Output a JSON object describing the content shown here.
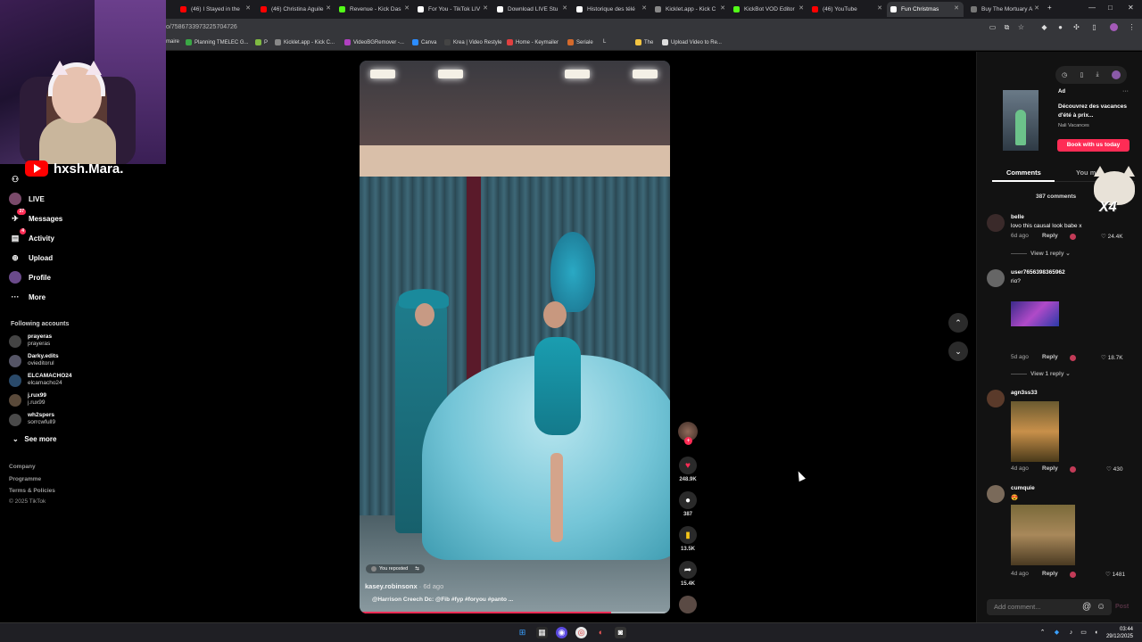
{
  "browser": {
    "tabs": [
      {
        "label": "(46) I Stayed in the",
        "color": "#ff0000"
      },
      {
        "label": "(46) Christina Aguile",
        "color": "#ff0000"
      },
      {
        "label": "Revenue - Kick Das",
        "color": "#53fc18"
      },
      {
        "label": "For You - TikTok LIV",
        "color": "#ffffff"
      },
      {
        "label": "Download LIVE Stu",
        "color": "#ffffff"
      },
      {
        "label": "Historique des télé",
        "color": "#ffffff"
      },
      {
        "label": "Kicklet.app - Kick C",
        "color": "#888888"
      },
      {
        "label": "KickBot VOD Editor",
        "color": "#53fc18"
      },
      {
        "label": "(46) YouTube",
        "color": "#ff0000"
      },
      {
        "label": "Fun Christmas",
        "color": "#ffffff"
      },
      {
        "label": "Buy The Mortuary A",
        "color": "#777777"
      }
    ],
    "url": "o/7586733973225704726",
    "bookmarks": [
      "maire",
      "Planning TMELEC G...",
      "P",
      "Kicklet.app - Kick C...",
      "VideoBGRemover -...",
      "Canva",
      "Krea | Video Restyle",
      "Home - Keymailer",
      "Seriale",
      "L",
      "The",
      "Upload Video to Re..."
    ]
  },
  "stream_overlay": {
    "channel_name": "hxsh.Mara."
  },
  "sidebar": {
    "nav": [
      {
        "label": "LIVE",
        "icon": "live-icon",
        "badge": ""
      },
      {
        "label": "Messages",
        "icon": "messages-icon",
        "badge": "37"
      },
      {
        "label": "Activity",
        "icon": "activity-icon",
        "badge": "4"
      },
      {
        "label": "Upload",
        "icon": "upload-icon",
        "badge": ""
      },
      {
        "label": "Profile",
        "icon": "profile-icon",
        "badge": ""
      },
      {
        "label": "More",
        "icon": "more-icon",
        "badge": ""
      }
    ],
    "following_title": "Following accounts",
    "accounts": [
      {
        "name": "prayeras",
        "handle": "prayeras"
      },
      {
        "name": "Darky.edits",
        "handle": "ovieditorul"
      },
      {
        "name": "ELCAMACHO24",
        "handle": "elcamacho24"
      },
      {
        "name": "j.rux99",
        "handle": "j.rux99"
      },
      {
        "name": "wh2spers",
        "handle": "sorrcwfull9"
      }
    ],
    "see_more": "See more",
    "footer": [
      "Company",
      "Programme",
      "Terms & Policies",
      "© 2025 TikTok"
    ]
  },
  "video": {
    "repost_label": "You reposted",
    "author": "kasey.robinsonx",
    "posted": "· 6d ago",
    "caption": "@Harrison Creech Dc: @Fib #fyp #foryou #panto ...",
    "progress": 0.81
  },
  "actions": {
    "likes": "248.9K",
    "comments": "387",
    "saves": "13.5K",
    "shares": "15.4K"
  },
  "panel": {
    "ad": {
      "label": "Ad",
      "title": "Découvrez des vacances d'été à prix...",
      "brand": "Nali Vacances",
      "cta": "Book with us today"
    },
    "tabs": {
      "comments": "Comments",
      "you": "You m"
    },
    "comment_count": "387 comments",
    "comments": [
      {
        "user": "belle",
        "text": "lovo this causal look babe x",
        "age": "6d ago",
        "likes": "24.4K",
        "replies": "View 1 reply"
      },
      {
        "user": "user7656398365962",
        "text": "rio?",
        "age": "5d ago",
        "likes": "18.7K",
        "replies": "View 1 reply"
      },
      {
        "user": "agn3ss33",
        "text": "",
        "age": "4d ago",
        "likes": "430",
        "replies": ""
      },
      {
        "user": "cumquie",
        "text": "😍",
        "age": "4d ago",
        "likes": "1481",
        "replies": ""
      }
    ],
    "reply_label": "Reply",
    "add_comment_placeholder": "Add comment...",
    "post_label": "Post"
  },
  "overlay_sticker": "X4",
  "taskbar": {
    "time": "03:44",
    "date": "29/12/2025"
  }
}
